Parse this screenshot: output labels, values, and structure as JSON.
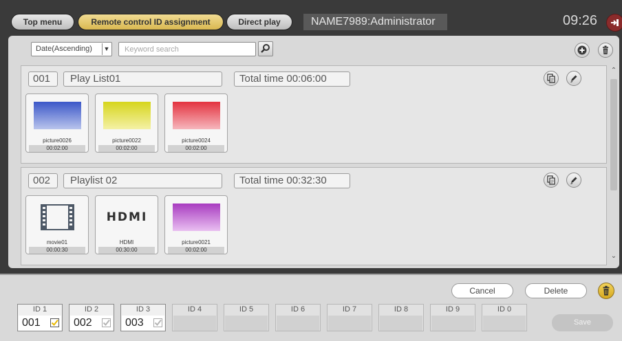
{
  "topbar": {
    "top_menu": "Top menu",
    "remote_id": "Remote control ID assignment",
    "direct_play": "Direct play",
    "user": "NAME7989:Administrator",
    "clock": "09:26"
  },
  "filters": {
    "sort_value": "Date(Ascending)",
    "search_placeholder": "Keyword search",
    "search_value": ""
  },
  "playlists": [
    {
      "num": "001",
      "name": "Play List01",
      "total": "Total time 00:06:00",
      "items": [
        {
          "name": "picture0026",
          "dur": "00:02:00",
          "thumb": "blue-gradient"
        },
        {
          "name": "picture0022",
          "dur": "00:02:00",
          "thumb": "yellow-gradient"
        },
        {
          "name": "picture0024",
          "dur": "00:02:00",
          "thumb": "red-gradient"
        }
      ]
    },
    {
      "num": "002",
      "name": "Playlist 02",
      "total": "Total time 00:32:30",
      "items": [
        {
          "name": "movie01",
          "dur": "00:00:30",
          "thumb": "film-icon"
        },
        {
          "name": "HDMI",
          "dur": "00:30:00",
          "thumb": "hdmi-logo"
        },
        {
          "name": "picture0021",
          "dur": "00:02:00",
          "thumb": "purple-gradient"
        }
      ]
    }
  ],
  "hdmi_logo_text": "HDMI",
  "bottom": {
    "cancel": "Cancel",
    "delete": "Delete",
    "save": "Save"
  },
  "ids": [
    {
      "label": "ID 1",
      "value": "001",
      "check": "active"
    },
    {
      "label": "ID 2",
      "value": "002",
      "check": "inactive"
    },
    {
      "label": "ID 3",
      "value": "003",
      "check": "inactive"
    },
    {
      "label": "ID 4",
      "value": "",
      "check": "none"
    },
    {
      "label": "ID 5",
      "value": "",
      "check": "none"
    },
    {
      "label": "ID 6",
      "value": "",
      "check": "none"
    },
    {
      "label": "ID 7",
      "value": "",
      "check": "none"
    },
    {
      "label": "ID 8",
      "value": "",
      "check": "none"
    },
    {
      "label": "ID 9",
      "value": "",
      "check": "none"
    },
    {
      "label": "ID 0",
      "value": "",
      "check": "none"
    }
  ],
  "colors": {
    "accent_gold": "#e6c65e",
    "logout_red": "#8a2b2b",
    "check_gold": "#e8b800"
  }
}
